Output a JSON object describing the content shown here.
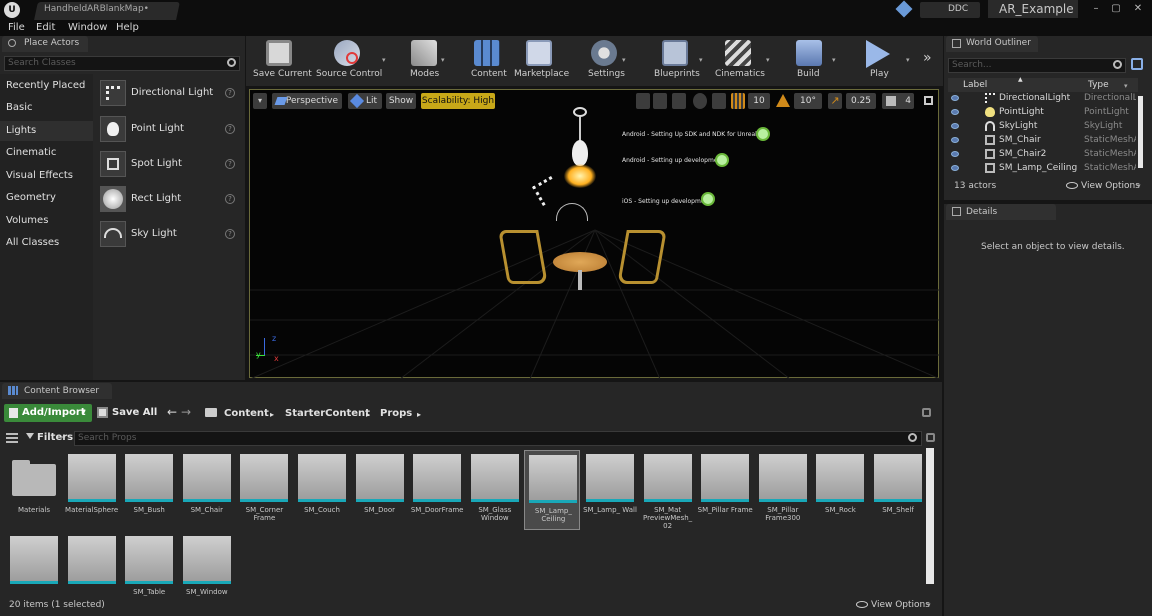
{
  "titlebar": {
    "map_tab": "HandheldARBlankMap",
    "map_tab_marker": "•",
    "ddc": "DDC",
    "project": "AR_Example",
    "min": "–",
    "max": "▢",
    "close": "✕",
    "logo": "U"
  },
  "menu": [
    "File",
    "Edit",
    "Window",
    "Help"
  ],
  "place_actors": {
    "tab": "Place Actors",
    "search_placeholder": "Search Classes",
    "categories": [
      "Recently Placed",
      "Basic",
      "Lights",
      "Cinematic",
      "Visual Effects",
      "Geometry",
      "Volumes",
      "All Classes"
    ],
    "selected_category": "Lights",
    "items": [
      "Directional Light",
      "Point Light",
      "Spot Light",
      "Rect Light",
      "Sky Light"
    ],
    "help": "?"
  },
  "toolbar": {
    "buttons": [
      "Save Current",
      "Source Control",
      "Modes",
      "Content",
      "Marketplace",
      "Settings",
      "Blueprints",
      "Cinematics",
      "Build",
      "Play"
    ],
    "more": "»",
    "dropdown": "▾"
  },
  "viewport": {
    "menu_arrow": "▾",
    "perspective": "Perspective",
    "lit": "Lit",
    "show": "Show",
    "scalability": "Scalability: High",
    "grid_snap": "10",
    "rotate_snap": "10°",
    "scale_snap": "0.25",
    "camera_speed": "4",
    "notes": [
      "Android - Setting Up SDK and NDK for Unreal",
      "Android - Setting up development",
      "iOS - Setting up development"
    ],
    "axis": {
      "z": "z",
      "y": "y",
      "x": "x"
    }
  },
  "outliner": {
    "tab": "World Outliner",
    "search_placeholder": "Search...",
    "col_label": "Label",
    "col_type": "Type",
    "sort_up": "▲",
    "sort_down": "▾",
    "rows": [
      {
        "label": "DirectionalLight",
        "type": "DirectionalL"
      },
      {
        "label": "PointLight",
        "type": "PointLight"
      },
      {
        "label": "SkyLight",
        "type": "SkyLight"
      },
      {
        "label": "SM_Chair",
        "type": "StaticMeshA"
      },
      {
        "label": "SM_Chair2",
        "type": "StaticMeshA"
      },
      {
        "label": "SM_Lamp_Ceiling",
        "type": "StaticMeshA"
      }
    ],
    "count": "13 actors",
    "view_options": "View Options"
  },
  "details": {
    "tab": "Details",
    "empty": "Select an object to view details."
  },
  "content_browser": {
    "tab": "Content Browser",
    "add_import": "Add/Import",
    "save_all": "Save All",
    "nav_back": "←",
    "nav_fwd": "→",
    "path": [
      "Content",
      "StarterContent",
      "Props"
    ],
    "path_sep": "▸",
    "filters": "Filters",
    "filter_arrow": "▾",
    "search_placeholder": "Search Props",
    "assets": [
      {
        "name": "Materials",
        "kind": "folder"
      },
      {
        "name": "MaterialSphere",
        "kind": "asset"
      },
      {
        "name": "SM_Bush",
        "kind": "asset"
      },
      {
        "name": "SM_Chair",
        "kind": "asset"
      },
      {
        "name": "SM_Corner Frame",
        "kind": "asset"
      },
      {
        "name": "SM_Couch",
        "kind": "asset"
      },
      {
        "name": "SM_Door",
        "kind": "asset"
      },
      {
        "name": "SM_DoorFrame",
        "kind": "asset"
      },
      {
        "name": "SM_Glass Window",
        "kind": "asset"
      },
      {
        "name": "SM_Lamp_ Ceiling",
        "kind": "selected"
      },
      {
        "name": "SM_Lamp_ Wall",
        "kind": "asset"
      },
      {
        "name": "SM_Mat PreviewMesh_ 02",
        "kind": "asset"
      },
      {
        "name": "SM_Pillar Frame",
        "kind": "asset"
      },
      {
        "name": "SM_Pillar Frame300",
        "kind": "asset"
      },
      {
        "name": "SM_Rock",
        "kind": "asset"
      },
      {
        "name": "SM_Shelf",
        "kind": "asset"
      },
      {
        "name": "",
        "kind": "asset"
      },
      {
        "name": "",
        "kind": "asset"
      },
      {
        "name": "SM_Table",
        "kind": "asset"
      },
      {
        "name": "SM_Window",
        "kind": "asset"
      }
    ],
    "status": "20 items (1 selected)",
    "view_options": "View Options"
  }
}
